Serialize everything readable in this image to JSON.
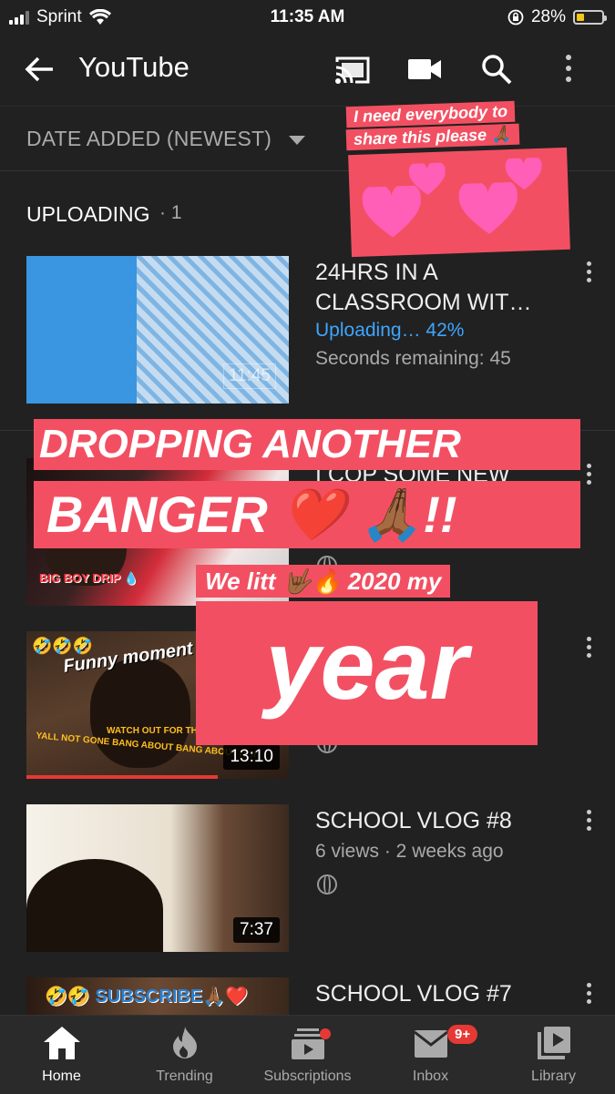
{
  "status_bar": {
    "carrier": "Sprint",
    "time": "11:35 AM",
    "battery": "28%"
  },
  "app_bar": {
    "title": "YouTube",
    "icons": [
      "back-arrow-icon",
      "cast-icon",
      "video-camera-icon",
      "search-icon",
      "more-vert-icon"
    ]
  },
  "sort": {
    "label": "DATE ADDED (NEWEST)"
  },
  "uploading": {
    "label": "UPLOADING",
    "sep": "·",
    "count": "1"
  },
  "videos": [
    {
      "title_line1": "24HRS IN A",
      "title_line2": "CLASSROOM WIT…",
      "status": "Uploading… 42%",
      "remaining": "Seconds remaining: 45",
      "duration": "11:45",
      "progress": 0.42
    },
    {
      "title_line1": "I COP SOME NEW",
      "thumb_text": "BIG BOY DRIP 💧"
    },
    {
      "duration": "13:10",
      "thumb_text_1": "🤣🤣🤣",
      "thumb_text_2": "Funny moment",
      "thumb_text_3": "WATCH OUT FOR THE",
      "thumb_text_4": "YALL NOT GONE BANG ABOUT BANG ABOUT IT !!"
    },
    {
      "title_line1": "SCHOOL VLOG #8",
      "meta": "6 views · 2 weeks ago",
      "duration": "7:37"
    },
    {
      "title_line1": "SCHOOL VLOG #7",
      "thumb_text": "🤣🤣 SUBSCRIBE🙏🏾❤️"
    }
  ],
  "overlay": {
    "line1": "I need everybody to",
    "line2": "share this please 🙏🏾",
    "big1": "DROPPING ANOTHER",
    "big2": "BANGER ❤️ 🙏🏾!!",
    "small": "We litt 🤟🏾🔥 2020 my",
    "year": "year"
  },
  "bottom_nav": [
    {
      "label": "Home",
      "icon": "home-icon",
      "active": true
    },
    {
      "label": "Trending",
      "icon": "flame-icon"
    },
    {
      "label": "Subscriptions",
      "icon": "subscriptions-icon"
    },
    {
      "label": "Inbox",
      "icon": "inbox-icon",
      "badge": "9+"
    },
    {
      "label": "Library",
      "icon": "library-icon"
    }
  ],
  "colors": {
    "background": "#212121",
    "accent_blue": "#3ea6ff",
    "sticker_pink": "#f25062",
    "badge_red": "#e53935"
  }
}
